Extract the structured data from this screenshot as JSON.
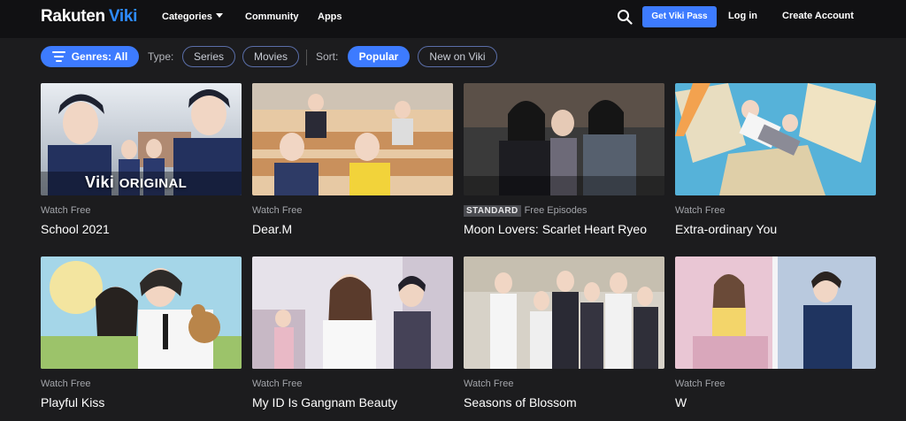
{
  "nav": {
    "logo_brand": "Rakuten",
    "logo_product": "Viki",
    "categories": "Categories",
    "community": "Community",
    "apps": "Apps",
    "get_pass": "Get Viki Pass",
    "login": "Log in",
    "create_account": "Create Account"
  },
  "filters": {
    "genres": "Genres: All",
    "type_label": "Type:",
    "series": "Series",
    "movies": "Movies",
    "sort_label": "Sort:",
    "popular": "Popular",
    "new_on_viki": "New on Viki"
  },
  "cards": [
    {
      "label": "Watch Free",
      "badge": "",
      "title": "School 2021",
      "overlay": "Viki",
      "overlay_sub": "ORIGINAL"
    },
    {
      "label": "Watch Free",
      "badge": "",
      "title": "Dear.M"
    },
    {
      "label": "Free Episodes",
      "badge": "STANDARD",
      "title": "Moon Lovers: Scarlet Heart Ryeo"
    },
    {
      "label": "Watch Free",
      "badge": "",
      "title": "Extra-ordinary You"
    },
    {
      "label": "Watch Free",
      "badge": "",
      "title": "Playful Kiss"
    },
    {
      "label": "Watch Free",
      "badge": "",
      "title": "My ID Is Gangnam Beauty"
    },
    {
      "label": "Watch Free",
      "badge": "",
      "title": "Seasons of Blossom"
    },
    {
      "label": "Watch Free",
      "badge": "",
      "title": "W"
    }
  ],
  "colors": {
    "accent": "#3d7bff",
    "brand": "#2e8bff",
    "nav_bg": "#111113",
    "page_bg": "#1c1c1e"
  },
  "icons": {
    "search": "search-icon",
    "genres": "sliders-icon",
    "caret": "chevron-down-icon"
  }
}
